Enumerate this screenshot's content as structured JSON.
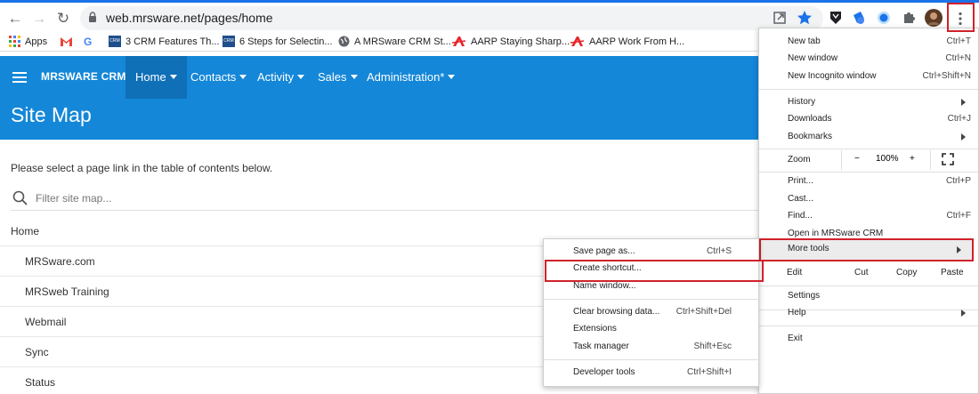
{
  "browser": {
    "url": "web.mrsware.net/pages/home",
    "bookmarks": [
      {
        "label": "Apps",
        "icon": "apps-grid-icon"
      },
      {
        "label": "",
        "icon": "gmail-icon"
      },
      {
        "label": "",
        "icon": "google-icon"
      },
      {
        "label": "3 CRM Features Th...",
        "icon": "crm-icon"
      },
      {
        "label": "6 Steps for Selectin...",
        "icon": "crm-icon"
      },
      {
        "label": "A MRSware CRM St...",
        "icon": "globe-icon"
      },
      {
        "label": "AARP Staying Sharp...",
        "icon": "aarp-icon"
      },
      {
        "label": "AARP Work From H...",
        "icon": "aarp-icon"
      }
    ],
    "crm_icon_text": "CRM"
  },
  "app": {
    "brand": "MRSWARE CRM",
    "menu": [
      {
        "label": "Home"
      },
      {
        "label": "Contacts"
      },
      {
        "label": "Activity"
      },
      {
        "label": "Sales"
      },
      {
        "label": "Administration*"
      }
    ],
    "page_title": "Site Map",
    "intro": "Please select a page link in the table of contents below.",
    "search_placeholder": "Filter site map...",
    "rows": [
      {
        "label": "Home"
      },
      {
        "label": "MRSware.com"
      },
      {
        "label": "MRSweb Training"
      },
      {
        "label": "Webmail"
      },
      {
        "label": "Sync"
      },
      {
        "label": "Status"
      }
    ]
  },
  "chrome_menu": {
    "new_tab": "New tab",
    "new_tab_sc": "Ctrl+T",
    "new_window": "New window",
    "new_window_sc": "Ctrl+N",
    "incognito": "New Incognito window",
    "incognito_sc": "Ctrl+Shift+N",
    "history": "History",
    "downloads": "Downloads",
    "downloads_sc": "Ctrl+J",
    "bookmarks": "Bookmarks",
    "zoom": "Zoom",
    "zoom_minus": "−",
    "zoom_level": "100%",
    "zoom_plus": "+",
    "print": "Print...",
    "print_sc": "Ctrl+P",
    "cast": "Cast...",
    "find": "Find...",
    "find_sc": "Ctrl+F",
    "open_in": "Open in MRSware CRM",
    "more_tools": "More tools",
    "edit": "Edit",
    "cut": "Cut",
    "copy": "Copy",
    "paste": "Paste",
    "settings": "Settings",
    "help": "Help",
    "exit": "Exit"
  },
  "more_tools_menu": {
    "save_page": "Save page as...",
    "save_page_sc": "Ctrl+S",
    "create_shortcut": "Create shortcut...",
    "name_window": "Name window...",
    "clear_data": "Clear browsing data...",
    "clear_data_sc": "Ctrl+Shift+Del",
    "extensions": "Extensions",
    "task_manager": "Task manager",
    "task_manager_sc": "Shift+Esc",
    "dev_tools": "Developer tools",
    "dev_tools_sc": "Ctrl+Shift+I"
  },
  "colors": {
    "app_blue": "#1487d8",
    "active_menu": "#0f6fb7",
    "highlight_red": "#d0222a"
  }
}
